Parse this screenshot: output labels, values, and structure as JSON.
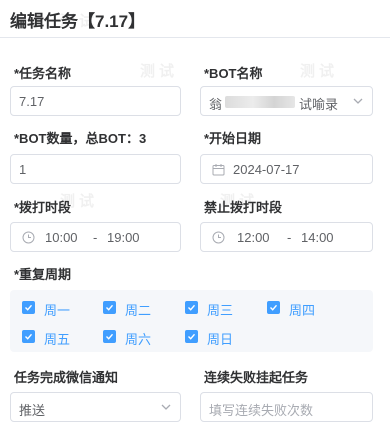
{
  "header": {
    "title": "编辑任务【7.17】"
  },
  "fields": {
    "task_name": {
      "label": "*任务名称",
      "value": "7.17"
    },
    "bot_name": {
      "label": "*BOT名称",
      "prefix": "翁",
      "suffix": "试喻录"
    },
    "bot_count": {
      "label": "*BOT数量，总BOT：3",
      "value": "1"
    },
    "start_date": {
      "label": "*开始日期",
      "value": "2024-07-17"
    },
    "dial_period": {
      "label": "*拨打时段",
      "start": "10:00",
      "separator": "-",
      "end": "19:00"
    },
    "forbid_period": {
      "label": "禁止拨打时段",
      "start": "12:00",
      "separator": "-",
      "end": "14:00"
    },
    "repeat": {
      "label": "*重复周期",
      "days": [
        "周一",
        "周二",
        "周三",
        "周四",
        "周五",
        "周六",
        "周日"
      ]
    },
    "wechat_notify": {
      "label": "任务完成微信通知",
      "value": "推送"
    },
    "auto_suspend": {
      "label": "连续失败挂起任务",
      "placeholder": "填写连续失败次数"
    }
  },
  "watermark": "测试",
  "colors": {
    "accent": "#409eff",
    "border": "#dcdfe6",
    "panel": "#f5f7fa"
  }
}
